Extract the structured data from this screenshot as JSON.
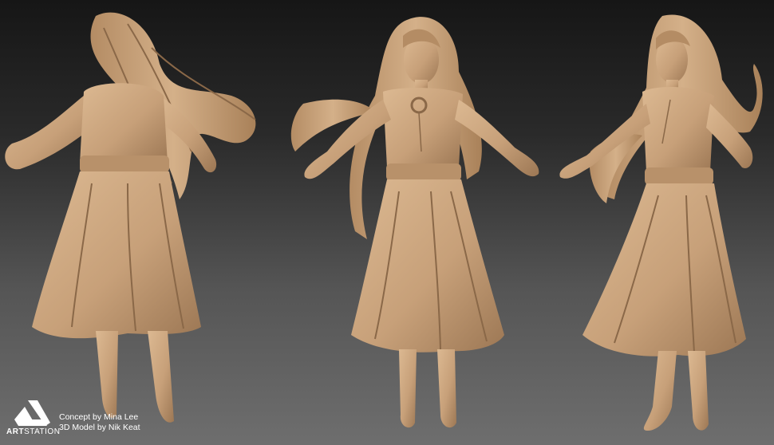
{
  "image": {
    "subject": "3D clay render turnaround of a long-haired girl in a flowing skirt",
    "views": [
      "back",
      "front",
      "three-quarter"
    ],
    "colors": {
      "clay": "#c7a079",
      "clay_shadow": "#8a6848",
      "clay_highlight": "#dcb992",
      "bg_top": "#161616",
      "bg_bottom": "#6e6e6e"
    }
  },
  "watermark": {
    "logo_icon": "artstation-logo-icon",
    "brand_bold": "ART",
    "brand_rest": "STATION",
    "credit_concept": "Concept by Mina Lee",
    "credit_model": "3D Model by Nik Keat"
  }
}
